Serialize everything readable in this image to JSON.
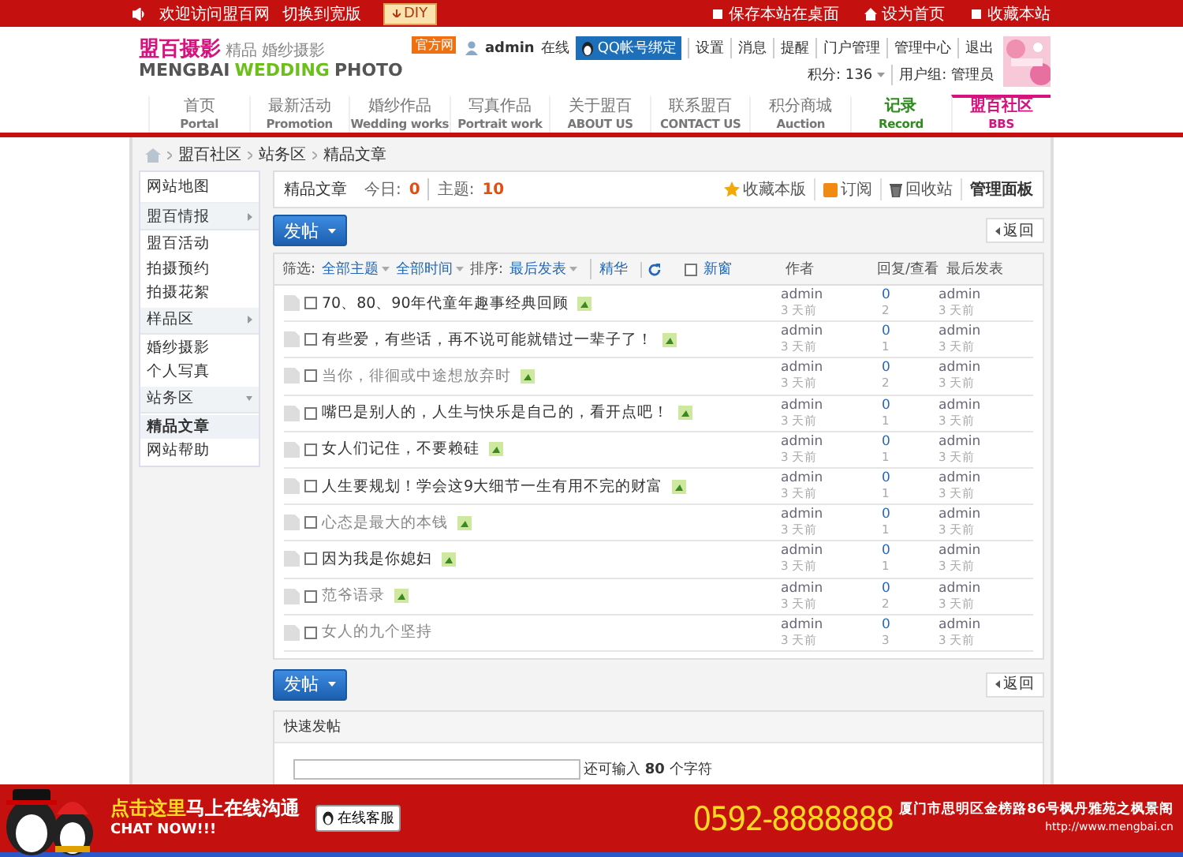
{
  "top_bar": {
    "welcome": "欢迎访问盟百网",
    "switch": "切换到宽版",
    "diy": "DIY",
    "links": [
      "保存本站在桌面",
      "设为首页",
      "收藏本站"
    ]
  },
  "logo": {
    "name": "盟百摄影",
    "tagline": "精品 婚纱摄影",
    "latin_1": "MENGBAI",
    "latin_2": "WEDDING",
    "latin_3": "PHOTO",
    "badge": "官方网"
  },
  "user": {
    "name": "admin",
    "status": "在线",
    "qq_button": "QQ帐号绑定",
    "links": [
      "设置",
      "消息",
      "提醒",
      "门户管理",
      "管理中心",
      "退出"
    ],
    "points": "积分: 136",
    "group": "用户组: 管理员"
  },
  "nav": [
    {
      "label": "首页",
      "sub": "Portal",
      "selected": false,
      "color": "#777777"
    },
    {
      "label": "最新活动",
      "sub": "Promotion",
      "selected": false,
      "color": "#777777"
    },
    {
      "label": "婚纱作品",
      "sub": "Wedding works",
      "selected": false,
      "color": "#777777"
    },
    {
      "label": "写真作品",
      "sub": "Portrait work",
      "selected": false,
      "color": "#777777"
    },
    {
      "label": "关于盟百",
      "sub": "ABOUT US",
      "selected": false,
      "color": "#777777"
    },
    {
      "label": "联系盟百",
      "sub": "CONTACT US",
      "selected": false,
      "color": "#777777"
    },
    {
      "label": "积分商城",
      "sub": "Auction",
      "selected": false,
      "color": "#777777"
    },
    {
      "label": "记录",
      "sub": "Record",
      "selected": false,
      "color": "#2e8b1e"
    },
    {
      "label": "盟百社区",
      "sub": "BBS",
      "selected": true,
      "color": "#d6127f"
    }
  ],
  "breadcrumb": [
    "盟百社区",
    "站务区",
    "精品文章"
  ],
  "sidebar": [
    {
      "kind": "link",
      "label": "网站地图"
    },
    {
      "kind": "group",
      "label": "盟百情报",
      "expanded": false,
      "items": [
        {
          "label": "盟百活动",
          "selected": false
        },
        {
          "label": "拍摄预约",
          "selected": false
        },
        {
          "label": "拍摄花絮",
          "selected": false
        }
      ]
    },
    {
      "kind": "group",
      "label": "样品区",
      "expanded": false,
      "items": [
        {
          "label": "婚纱摄影",
          "selected": false
        },
        {
          "label": "个人写真",
          "selected": false
        }
      ]
    },
    {
      "kind": "group",
      "label": "站务区",
      "expanded": true,
      "items": [
        {
          "label": "精品文章",
          "selected": true
        },
        {
          "label": "网站帮助",
          "selected": false
        }
      ]
    }
  ],
  "forum": {
    "title": "精品文章",
    "today_label": "今日:",
    "today": "0",
    "topics_label": "主题:",
    "topics": "10",
    "actions": [
      "收藏本版",
      "订阅",
      "回收站"
    ],
    "admin_panel": "管理面板"
  },
  "top_actions": {
    "post_button": "发帖",
    "back_button": "返回"
  },
  "bottom_actions": {
    "post_button": "发帖",
    "back_button": "返回"
  },
  "filter": {
    "label": "筛选:",
    "options": [
      "全部主题",
      "全部时间"
    ],
    "sort_label": "排序:",
    "sort": "最后发表",
    "digest": "精华",
    "new_window": "新窗",
    "new_window_checked": false,
    "columns": [
      "作者",
      "回复/查看",
      "最后发表"
    ]
  },
  "threads": [
    {
      "title": "70、80、90年代童年趣事经典回顾",
      "checked": false,
      "dimmed": false,
      "has_image": true,
      "author": "admin",
      "date": "3 天前",
      "replies": "0",
      "views": "2",
      "last_by": "admin",
      "last_date": "3 天前"
    },
    {
      "title": "有些爱，有些话，再不说可能就错过一辈子了！",
      "checked": false,
      "dimmed": false,
      "has_image": true,
      "author": "admin",
      "date": "3 天前",
      "replies": "0",
      "views": "1",
      "last_by": "admin",
      "last_date": "3 天前"
    },
    {
      "title": "当你，徘徊或中途想放弃时",
      "checked": false,
      "dimmed": true,
      "has_image": true,
      "author": "admin",
      "date": "3 天前",
      "replies": "0",
      "views": "2",
      "last_by": "admin",
      "last_date": "3 天前"
    },
    {
      "title": "嘴巴是别人的，人生与快乐是自己的，看开点吧！",
      "checked": false,
      "dimmed": false,
      "has_image": true,
      "author": "admin",
      "date": "3 天前",
      "replies": "0",
      "views": "1",
      "last_by": "admin",
      "last_date": "3 天前"
    },
    {
      "title": "女人们记住，不要赖硅",
      "checked": false,
      "dimmed": false,
      "has_image": true,
      "author": "admin",
      "date": "3 天前",
      "replies": "0",
      "views": "1",
      "last_by": "admin",
      "last_date": "3 天前"
    },
    {
      "title": "人生要规划！学会这9大细节一生有用不完的财富",
      "checked": false,
      "dimmed": false,
      "has_image": true,
      "author": "admin",
      "date": "3 天前",
      "replies": "0",
      "views": "1",
      "last_by": "admin",
      "last_date": "3 天前"
    },
    {
      "title": "心态是最大的本钱",
      "checked": false,
      "dimmed": true,
      "has_image": true,
      "author": "admin",
      "date": "3 天前",
      "replies": "0",
      "views": "1",
      "last_by": "admin",
      "last_date": "3 天前"
    },
    {
      "title": "因为我是你媳妇",
      "checked": false,
      "dimmed": false,
      "has_image": true,
      "author": "admin",
      "date": "3 天前",
      "replies": "0",
      "views": "1",
      "last_by": "admin",
      "last_date": "3 天前"
    },
    {
      "title": "范爷语录",
      "checked": false,
      "dimmed": true,
      "has_image": true,
      "author": "admin",
      "date": "3 天前",
      "replies": "0",
      "views": "2",
      "last_by": "admin",
      "last_date": "3 天前"
    },
    {
      "title": "女人的九个坚持",
      "checked": false,
      "dimmed": true,
      "has_image": false,
      "author": "admin",
      "date": "3 天前",
      "replies": "0",
      "views": "3",
      "last_by": "admin",
      "last_date": "3 天前"
    }
  ],
  "quick_post": {
    "title": "快速发帖",
    "hint_before": "还可输入",
    "count": "80",
    "hint_after": "个字符"
  },
  "chat_bar": {
    "click_here": "点击这里",
    "online": "马上在线沟通",
    "chat_now": "CHAT NOW!!!",
    "service": "在线客服",
    "phone": "0592-8888888",
    "address": "厦门市思明区金榜路86号枫丹雅苑之枫景阁",
    "url": "http://www.mengbai.cn"
  }
}
